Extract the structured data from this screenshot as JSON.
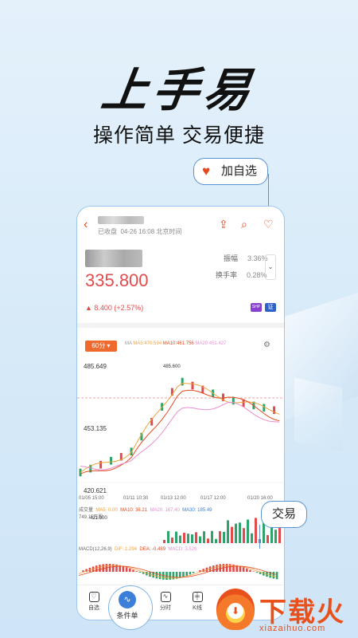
{
  "hero": {
    "title": "上手易",
    "subtitle": "操作简单 交易便捷"
  },
  "callouts": {
    "favorite": "加自选",
    "trade": "交易"
  },
  "stock": {
    "status": "已收盘",
    "datetime": "04-26 16:08 北京时间",
    "price": "335.800",
    "change": "▲ 8.400 (+2.57%)",
    "amplitude_label": "振幅",
    "amplitude_value": "3.36%",
    "turnover_label": "换手率",
    "turnover_value": "0.28%",
    "badge_shp": "SHP",
    "badge_tn": "证"
  },
  "chart": {
    "period": "60分 ▾",
    "ma_label": "MA",
    "ma5": "MA5:470.594",
    "ma10": "MA10:461.756",
    "ma20": "MA20:451.427",
    "y_high": "485.649",
    "y_mid": "453.135",
    "y_low": "420.621",
    "high_marker": "485.600",
    "low_marker": "421.000",
    "x_ticks": [
      "01/05 15:00",
      "01/11 10:30",
      "01/13 12:00",
      "01/17 12:00",
      "01/20 16:00"
    ],
    "vol_label": "成交量",
    "vol_ma5": "MA5: 0.00",
    "vol_ma10": "MA10: 38.21",
    "vol_ma20": "MA20: 167.40",
    "vol_ma30": "MA30: 185.49",
    "vol_total": "749.15万股",
    "macd_label": "MACD(12,26,9)",
    "macd_dif": "DIF: 1.294",
    "macd_dea": "DEA: -0.489",
    "macd_val": "MACD: 3.526"
  },
  "chart_data": {
    "type": "line",
    "ylim": [
      420.621,
      485.649
    ],
    "x": [
      "01/05 15:00",
      "01/11 10:30",
      "01/13 12:00",
      "01/17 12:00",
      "01/20 16:00"
    ],
    "series": [
      {
        "name": "MA5",
        "values": [
          430,
          440,
          478,
          468,
          462
        ]
      },
      {
        "name": "MA10",
        "values": [
          428,
          436,
          472,
          470,
          458
        ]
      },
      {
        "name": "MA20",
        "values": [
          432,
          434,
          462,
          466,
          456
        ]
      }
    ]
  },
  "tabs": [
    "自选",
    "条件单",
    "分时",
    "K线"
  ],
  "logo": {
    "cn": "下载火",
    "en": "xiazaihuo.com"
  },
  "colors": {
    "accent": "#e2491e",
    "up": "#e24b4b",
    "down": "#2ea36b",
    "brand_blue": "#3b7fd9"
  }
}
